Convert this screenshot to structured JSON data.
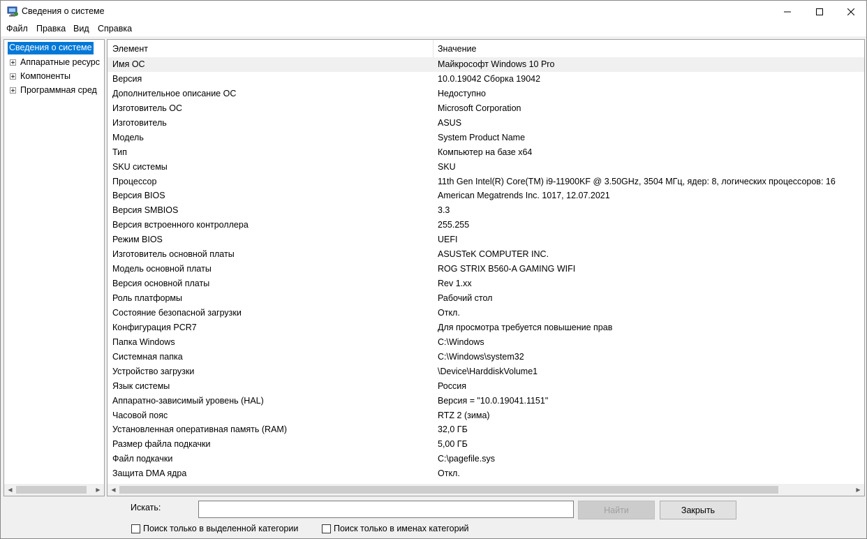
{
  "window": {
    "title": "Сведения о системе",
    "icon": "msinfo-computer-icon",
    "controls": [
      "minimize-icon",
      "maximize-icon",
      "close-icon"
    ]
  },
  "menu": {
    "file": "Файл",
    "edit": "Правка",
    "view": "Вид",
    "help": "Справка"
  },
  "tree": {
    "root": "Сведения о системе",
    "children": [
      "Аппаратные ресурс",
      "Компоненты",
      "Программная сред"
    ]
  },
  "list": {
    "col_name": "Элемент",
    "col_value": "Значение",
    "rows": [
      {
        "name": "Имя ОС",
        "value": "Майкрософт Windows 10 Pro"
      },
      {
        "name": "Версия",
        "value": "10.0.19042 Сборка 19042"
      },
      {
        "name": "Дополнительное описание ОС",
        "value": "Недоступно"
      },
      {
        "name": "Изготовитель ОС",
        "value": "Microsoft Corporation"
      },
      {
        "name": "Изготовитель",
        "value": "ASUS"
      },
      {
        "name": "Модель",
        "value": "System Product Name"
      },
      {
        "name": "Тип",
        "value": "Компьютер на базе x64"
      },
      {
        "name": "SKU системы",
        "value": "SKU"
      },
      {
        "name": "Процессор",
        "value": "11th Gen Intel(R) Core(TM) i9-11900KF @ 3.50GHz, 3504 МГц, ядер: 8, логических процессоров: 16"
      },
      {
        "name": "Версия BIOS",
        "value": "American Megatrends Inc. 1017, 12.07.2021"
      },
      {
        "name": "Версия SMBIOS",
        "value": "3.3"
      },
      {
        "name": "Версия встроенного контроллера",
        "value": "255.255"
      },
      {
        "name": "Режим BIOS",
        "value": "UEFI"
      },
      {
        "name": "Изготовитель основной платы",
        "value": "ASUSTeK COMPUTER INC."
      },
      {
        "name": "Модель основной платы",
        "value": "ROG STRIX B560-A GAMING WIFI"
      },
      {
        "name": "Версия основной платы",
        "value": "Rev 1.xx"
      },
      {
        "name": "Роль платформы",
        "value": "Рабочий стол"
      },
      {
        "name": "Состояние безопасной загрузки",
        "value": "Откл."
      },
      {
        "name": "Конфигурация PCR7",
        "value": "Для просмотра требуется повышение прав"
      },
      {
        "name": "Папка Windows",
        "value": "C:\\Windows"
      },
      {
        "name": "Системная папка",
        "value": "C:\\Windows\\system32"
      },
      {
        "name": "Устройство загрузки",
        "value": "\\Device\\HarddiskVolume1"
      },
      {
        "name": "Язык системы",
        "value": "Россия"
      },
      {
        "name": "Аппаратно-зависимый уровень (HAL)",
        "value": "Версия = \"10.0.19041.1151\""
      },
      {
        "name": "Часовой пояс",
        "value": "RTZ 2 (зима)"
      },
      {
        "name": "Установленная оперативная память (RAM)",
        "value": "32,0 ГБ"
      },
      {
        "name": "Размер файла подкачки",
        "value": "5,00 ГБ"
      },
      {
        "name": "Файл подкачки",
        "value": "C:\\pagefile.sys"
      },
      {
        "name": "Защита DMA ядра",
        "value": "Откл."
      }
    ]
  },
  "search": {
    "label": "Искать:",
    "value": "",
    "find_button": "Найти",
    "close_button": "Закрыть",
    "check_selected_category": "Поиск только в выделенной категории",
    "check_category_names": "Поиск только в именах категорий"
  },
  "colors": {
    "selection": "#0078d7",
    "window_bg": "#f0f0f0",
    "panel_bg": "#ffffff"
  }
}
